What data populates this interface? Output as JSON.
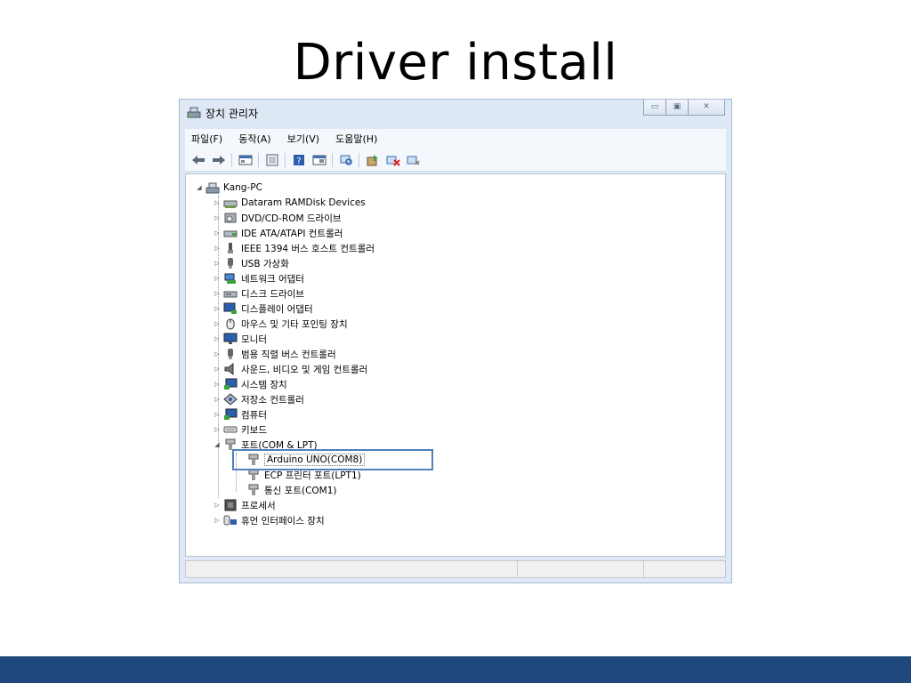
{
  "slide": {
    "title": "Driver install"
  },
  "window": {
    "title": "장치 관리자",
    "minimize": "▭",
    "maximize": "▣",
    "close": "✕"
  },
  "menu": [
    "파일(F)",
    "동작(A)",
    "보기(V)",
    "도움말(H)"
  ],
  "toolbar_icons": [
    "back-icon",
    "forward-icon",
    "properties-icon",
    "update-icon",
    "help-icon",
    "show-hidden-icon",
    "scan-icon",
    "update-driver-icon",
    "uninstall-icon",
    "disable-icon"
  ],
  "tree": {
    "root": "Kang-PC",
    "items": [
      "Dataram RAMDisk Devices",
      "DVD/CD-ROM 드라이브",
      "IDE ATA/ATAPI 컨트롤러",
      "IEEE 1394 버스 호스트 컨트롤러",
      "USB 가상화",
      "네트워크 어댑터",
      "디스크 드라이브",
      "디스플레이 어댑터",
      "마우스 및 기타 포인팅 장치",
      "모니터",
      "범용 직렬 버스 컨트롤러",
      "사운드, 비디오 및 게임 컨트롤러",
      "시스템 장치",
      "저장소 컨트롤러",
      "컴퓨터",
      "키보드",
      "포트(COM & LPT)"
    ],
    "port_children": [
      "Arduino UNO(COM8)",
      "ECP 프린터 포트(LPT1)",
      "통신 포트(COM1)"
    ],
    "after_items": [
      "프로세서",
      "휴먼 인터페이스 장치"
    ]
  },
  "colors": {
    "accent_bar": "#1f497d",
    "highlight": "#4f81bd",
    "window_frame": "#dfe9f5"
  }
}
